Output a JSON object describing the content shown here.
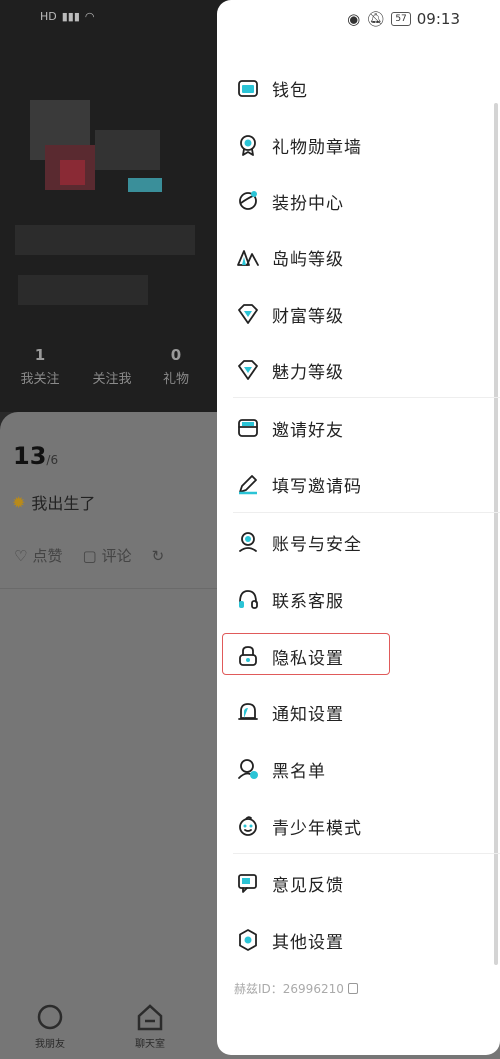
{
  "status": {
    "time": "09:13",
    "battery": "57"
  },
  "profile": {
    "stats": [
      {
        "num": "1",
        "label": "我关注"
      },
      {
        "num": "",
        "label": "关注我"
      },
      {
        "num": "0",
        "label": "礼物"
      }
    ],
    "post_count": "13",
    "post_total": "/6",
    "born_text": "我出生了",
    "actions": {
      "like": "点赞",
      "comment": "评论"
    },
    "bottom_tabs": [
      "我朋友",
      "聊天室"
    ]
  },
  "menu": {
    "items": [
      {
        "label": "钱包",
        "icon": "wallet-icon"
      },
      {
        "label": "礼物勋章墙",
        "icon": "medal-icon"
      },
      {
        "label": "装扮中心",
        "icon": "planet-icon"
      },
      {
        "label": "岛屿等级",
        "icon": "island-icon"
      },
      {
        "label": "财富等级",
        "icon": "diamond-icon"
      },
      {
        "label": "魅力等级",
        "icon": "diamond-icon"
      },
      {
        "label": "邀请好友",
        "icon": "envelope-icon"
      },
      {
        "label": "填写邀请码",
        "icon": "pen-icon"
      },
      {
        "label": "账号与安全",
        "icon": "user-shield-icon"
      },
      {
        "label": "联系客服",
        "icon": "headset-icon"
      },
      {
        "label": "隐私设置",
        "icon": "lock-icon"
      },
      {
        "label": "通知设置",
        "icon": "bell-icon"
      },
      {
        "label": "黑名单",
        "icon": "blocked-user-icon"
      },
      {
        "label": "青少年模式",
        "icon": "child-icon"
      },
      {
        "label": "意见反馈",
        "icon": "feedback-icon"
      },
      {
        "label": "其他设置",
        "icon": "settings-icon"
      }
    ],
    "footer_id": "赫兹ID：26996210"
  },
  "colors": {
    "accent": "#2bc4d6",
    "highlight_border": "#e05a5a"
  }
}
